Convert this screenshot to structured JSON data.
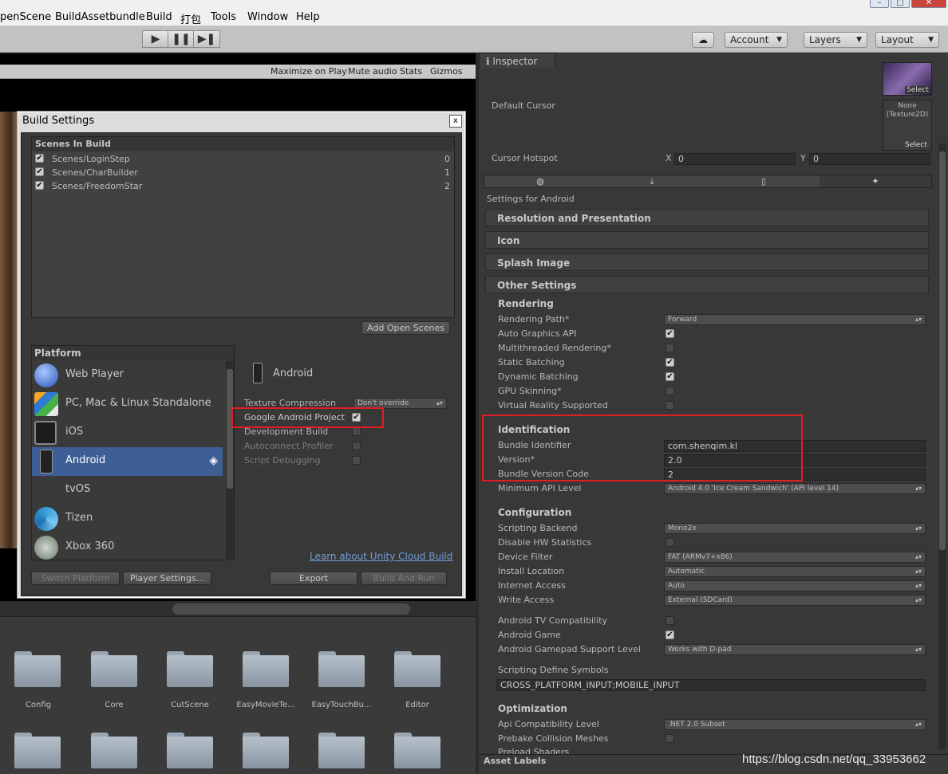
{
  "menu": [
    "penScene",
    "BuildAssetbundle",
    "Build",
    "打包",
    "Tools",
    "Window",
    "Help"
  ],
  "toolbar": {
    "account": "Account",
    "layers": "Layers",
    "layout": "Layout"
  },
  "gamebar": [
    "Maximize on Play",
    "Mute audio",
    "Stats",
    "Gizmos"
  ],
  "build_settings": {
    "title": "Build Settings",
    "scenes_header": "Scenes In Build",
    "scenes": [
      {
        "name": "Scenes/LoginStep",
        "index": "0"
      },
      {
        "name": "Scenes/CharBuilder",
        "index": "1"
      },
      {
        "name": "Scenes/FreedomStar",
        "index": "2"
      }
    ],
    "add_open_scenes": "Add Open Scenes",
    "platform_header": "Platform",
    "platforms": [
      "Web Player",
      "PC, Mac & Linux Standalone",
      "iOS",
      "Android",
      "tvOS",
      "Tizen",
      "Xbox 360"
    ],
    "selected_platform": "Android",
    "options": {
      "texture_compression": "Texture Compression",
      "texture_compression_value": "Don't override",
      "google_android_project": "Google Android Project",
      "development_build": "Development Build",
      "autoconnect_profiler": "Autoconnect Profiler",
      "script_debugging": "Script Debugging"
    },
    "cloud_link": "Learn about Unity Cloud Build",
    "switch_platform": "Switch Platform",
    "player_settings": "Player Settings...",
    "export": "Export",
    "build_and_run": "Build And Run"
  },
  "project_folders": [
    "Config",
    "Core",
    "CutScene",
    "EasyMovieTe...",
    "EasyTouchBu...",
    "Editor"
  ],
  "inspector": {
    "tab": "Inspector",
    "select1": "Select",
    "none_texture": "None\n(Texture2D)",
    "select2": "Select",
    "default_cursor": "Default Cursor",
    "cursor_hotspot": "Cursor Hotspot",
    "hotspot_x_label": "X",
    "hotspot_x": "0",
    "hotspot_y_label": "Y",
    "hotspot_y": "0",
    "settings_for": "Settings for Android",
    "sections": [
      "Resolution and Presentation",
      "Icon",
      "Splash Image",
      "Other Settings"
    ],
    "rendering": {
      "header": "Rendering",
      "rendering_path_label": "Rendering Path*",
      "rendering_path": "Forward",
      "auto_graphics": "Auto Graphics API",
      "multithreaded": "Multithreaded Rendering*",
      "static_batching": "Static Batching",
      "dynamic_batching": "Dynamic Batching",
      "gpu_skinning": "GPU Skinning*",
      "vr_supported": "Virtual Reality Supported"
    },
    "identification": {
      "header": "Identification",
      "bundle_id_label": "Bundle Identifier",
      "bundle_id": "com.shenqim.kl",
      "version_label": "Version*",
      "version": "2.0",
      "version_code_label": "Bundle Version Code",
      "version_code": "2",
      "min_api_label": "Minimum API Level",
      "min_api": "Android 4.0 'Ice Cream Sandwich' (API level 14)"
    },
    "configuration": {
      "header": "Configuration",
      "scripting_backend_label": "Scripting Backend",
      "scripting_backend": "Mono2x",
      "disable_hw": "Disable HW Statistics",
      "device_filter_label": "Device Filter",
      "device_filter": "FAT (ARMv7+x86)",
      "install_location_label": "Install Location",
      "install_location": "Automatic",
      "internet_access_label": "Internet Access",
      "internet_access": "Auto",
      "write_access_label": "Write Access",
      "write_access": "External (SDCard)",
      "tv_compat": "Android TV Compatibility",
      "android_game": "Android Game",
      "gamepad_label": "Android Gamepad Support Level",
      "gamepad": "Works with D-pad",
      "define_symbols_label": "Scripting Define Symbols",
      "define_symbols": "CROSS_PLATFORM_INPUT;MOBILE_INPUT"
    },
    "optimization": {
      "header": "Optimization",
      "api_compat_label": "Api Compatibility Level",
      "api_compat": ".NET 2.0 Subset",
      "prebake": "Prebake Collision Meshes",
      "preload": "Preload Shaders"
    },
    "asset_labels": "Asset Labels"
  },
  "watermark": "https://blog.csdn.net/qq_33953662",
  "colors": {
    "selected": "#3e5f96",
    "highlight": "#e01e24",
    "link": "#6f9fd8"
  }
}
